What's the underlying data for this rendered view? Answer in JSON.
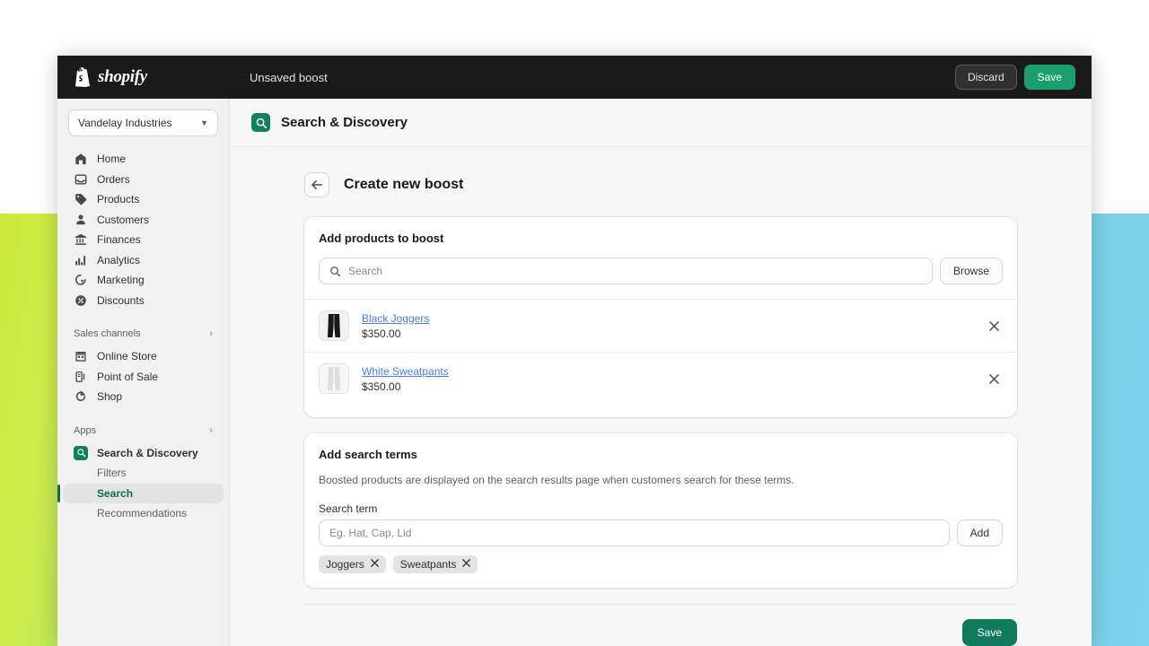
{
  "topbar": {
    "brand": "shopify",
    "title": "Unsaved boost",
    "discard_label": "Discard",
    "save_label": "Save"
  },
  "sidebar": {
    "store": "Vandelay Industries",
    "items": [
      {
        "label": "Home",
        "icon": "home-icon"
      },
      {
        "label": "Orders",
        "icon": "orders-icon"
      },
      {
        "label": "Products",
        "icon": "tag-icon"
      },
      {
        "label": "Customers",
        "icon": "person-icon"
      },
      {
        "label": "Finances",
        "icon": "bank-icon"
      },
      {
        "label": "Analytics",
        "icon": "bar-chart-icon"
      },
      {
        "label": "Marketing",
        "icon": "marketing-icon"
      },
      {
        "label": "Discounts",
        "icon": "discount-icon"
      }
    ],
    "sections": [
      {
        "label": "Sales channels",
        "items": [
          {
            "label": "Online Store",
            "icon": "storefront-icon"
          },
          {
            "label": "Point of Sale",
            "icon": "pos-icon"
          },
          {
            "label": "Shop",
            "icon": "shop-icon"
          }
        ]
      },
      {
        "label": "Apps",
        "items": [
          {
            "label": "Search & Discovery",
            "icon": "search-discovery-icon"
          }
        ],
        "sub_items": [
          {
            "label": "Filters",
            "active": false
          },
          {
            "label": "Search",
            "active": true
          },
          {
            "label": "Recommendations",
            "active": false
          }
        ]
      }
    ]
  },
  "app_header": {
    "title": "Search & Discovery",
    "icon": "search-discovery-icon"
  },
  "page": {
    "title": "Create new boost",
    "back_icon": "arrow-left-icon"
  },
  "products_card": {
    "title": "Add products to boost",
    "search_placeholder": "Search",
    "search_value": "",
    "browse_label": "Browse",
    "rows": [
      {
        "name": "Black Joggers",
        "price": "$350.00",
        "thumb": "black-joggers"
      },
      {
        "name": "White Sweatpants",
        "price": "$350.00",
        "thumb": "white-sweatpants"
      }
    ]
  },
  "terms_card": {
    "title": "Add search terms",
    "description": "Boosted products are displayed on the search results page when customers search for these terms.",
    "field_label": "Search term",
    "input_placeholder": "Eg. Hat, Cap, Lid",
    "input_value": "",
    "add_label": "Add",
    "tags": [
      "Joggers",
      "Sweatpants"
    ]
  },
  "footer": {
    "save_label": "Save"
  },
  "colors": {
    "brand_green": "#108060",
    "save_green": "#1a9e6e",
    "save_green_dark": "#0f7a5c",
    "active_green": "#0f6e52",
    "link_blue": "#4a7fd4",
    "topbar_black": "#1a1a1a"
  }
}
